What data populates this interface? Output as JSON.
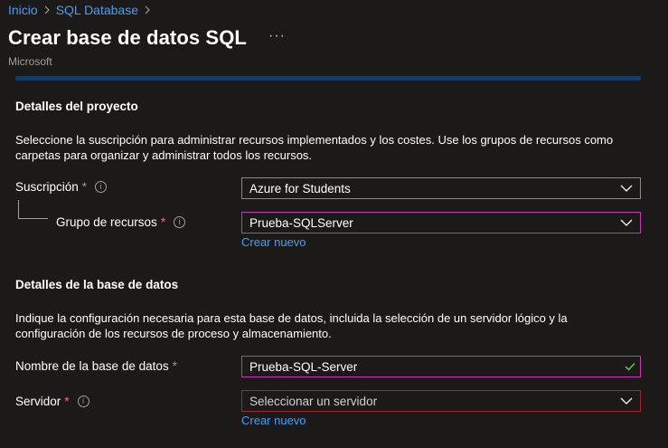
{
  "breadcrumb": {
    "items": [
      "Inicio",
      "SQL Database"
    ]
  },
  "header": {
    "title": "Crear base de datos SQL",
    "more": "···",
    "publisher": "Microsoft"
  },
  "project": {
    "title": "Detalles del proyecto",
    "description": "Seleccione la suscripción para administrar recursos implementados y los costes. Use los grupos de recursos como carpetas para organizar y administrar todos los recursos.",
    "subscription": {
      "label": "Suscripción",
      "required": "*",
      "info": "i",
      "value": "Azure for Students"
    },
    "resource_group": {
      "label": "Grupo de recursos",
      "required": "*",
      "info": "i",
      "value": "Prueba-SQLServer",
      "create_new": "Crear nuevo"
    }
  },
  "database": {
    "title": "Detalles de la base de datos",
    "description": "Indique la configuración necesaria para esta base de datos, incluida la selección de un servidor lógico y la configuración de los recursos de proceso y almacenamiento.",
    "name": {
      "label": "Nombre de la base de datos",
      "required": "*",
      "value": "Prueba-SQL-Server"
    },
    "server": {
      "label": "Servidor",
      "required": "*",
      "info": "i",
      "placeholder": "Seleccionar un servidor",
      "create_new": "Crear nuevo"
    }
  },
  "colors": {
    "accent_link": "#479ef5",
    "focus_border": "#c239b3",
    "error_border": "#a4262c",
    "required": "#f1707b",
    "background": "#1b1a19"
  }
}
